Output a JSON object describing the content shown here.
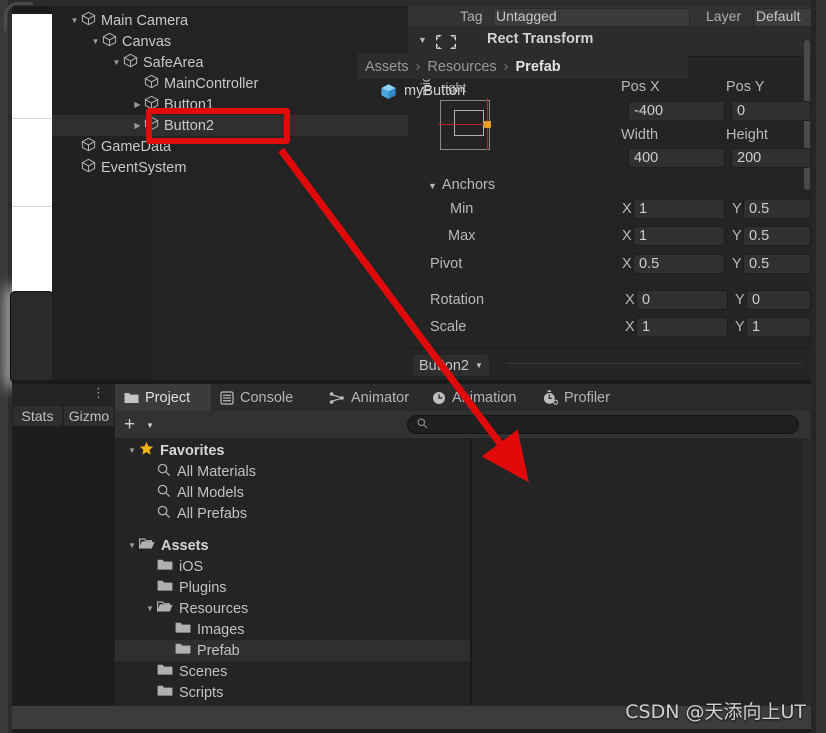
{
  "app": "Unity Editor",
  "hierarchy": {
    "items": [
      {
        "label": "Main Camera",
        "indent": 0,
        "expander": "down",
        "icon": "gameobject-cube-icon",
        "selected": false
      },
      {
        "label": "Canvas",
        "indent": 1,
        "expander": "down",
        "icon": "gameobject-cube-icon",
        "selected": false
      },
      {
        "label": "SafeArea",
        "indent": 2,
        "expander": "down",
        "icon": "gameobject-cube-icon",
        "selected": false
      },
      {
        "label": "MainController",
        "indent": 3,
        "expander": "none",
        "icon": "gameobject-cube-icon",
        "selected": false
      },
      {
        "label": "Button1",
        "indent": 3,
        "expander": "right",
        "icon": "gameobject-cube-icon",
        "selected": false
      },
      {
        "label": "Button2",
        "indent": 3,
        "expander": "right",
        "icon": "gameobject-cube-icon",
        "selected": true
      },
      {
        "label": "GameData",
        "indent": 0,
        "expander": "none",
        "icon": "gameobject-cube-icon",
        "selected": false
      },
      {
        "label": "EventSystem",
        "indent": 0,
        "expander": "none",
        "icon": "gameobject-cube-icon",
        "selected": false
      }
    ]
  },
  "inspector": {
    "tag_label": "Tag",
    "tag_value": "Untagged",
    "layer_label": "Layer",
    "layer_value": "Default",
    "component": {
      "title": "Rect Transform",
      "icon": "rect-transform-icon",
      "anchor_preset": {
        "horizontal": "right",
        "vertical": "middle"
      },
      "fields": {
        "pos_x_label": "Pos X",
        "pos_x_value": "-400",
        "pos_y_label": "Pos Y",
        "pos_y_value": "0",
        "width_label": "Width",
        "width_value": "400",
        "height_label": "Height",
        "height_value": "200",
        "anchors_label": "Anchors",
        "min_label": "Min",
        "min_x": "1",
        "min_y": "0.5",
        "max_label": "Max",
        "max_x": "1",
        "max_y": "0.5",
        "pivot_label": "Pivot",
        "pivot_x": "0.5",
        "pivot_y": "0.5",
        "rotation_label": "Rotation",
        "rotation_x": "0",
        "rotation_y": "0",
        "scale_label": "Scale",
        "scale_x": "1",
        "scale_y": "1",
        "axis_x": "X",
        "axis_y": "Y"
      }
    },
    "footer_dropdown": "Button2"
  },
  "scene_toolbar": {
    "stats_label": "Stats",
    "gizmos_label": "Gizmo"
  },
  "project": {
    "tabs": [
      {
        "label": "Project",
        "icon": "folder-icon",
        "active": true
      },
      {
        "label": "Console",
        "icon": "console-icon",
        "active": false
      },
      {
        "label": "Animator",
        "icon": "animator-icon",
        "active": false
      },
      {
        "label": "Animation",
        "icon": "animation-clock-icon",
        "active": false
      },
      {
        "label": "Profiler",
        "icon": "profiler-stopwatch-icon",
        "active": false
      }
    ],
    "toolbar": {
      "create_label": "+",
      "search_placeholder": ""
    },
    "tree": [
      {
        "label": "Favorites",
        "indent": 0,
        "expander": "down",
        "icon": "star-icon",
        "bold": true,
        "selected": false
      },
      {
        "label": "All Materials",
        "indent": 1,
        "expander": "none",
        "icon": "search-icon",
        "bold": false,
        "selected": false
      },
      {
        "label": "All Models",
        "indent": 1,
        "expander": "none",
        "icon": "search-icon",
        "bold": false,
        "selected": false
      },
      {
        "label": "All Prefabs",
        "indent": 1,
        "expander": "none",
        "icon": "search-icon",
        "bold": false,
        "selected": false
      },
      {
        "label": "Assets",
        "indent": 0,
        "expander": "down",
        "icon": "folder-open-icon",
        "bold": true,
        "selected": false
      },
      {
        "label": "iOS",
        "indent": 1,
        "expander": "none",
        "icon": "folder-icon",
        "bold": false,
        "selected": false
      },
      {
        "label": "Plugins",
        "indent": 1,
        "expander": "none",
        "icon": "folder-icon",
        "bold": false,
        "selected": false
      },
      {
        "label": "Resources",
        "indent": 1,
        "expander": "down",
        "icon": "folder-open-icon",
        "bold": false,
        "selected": false
      },
      {
        "label": "Images",
        "indent": 2,
        "expander": "none",
        "icon": "folder-icon",
        "bold": false,
        "selected": false
      },
      {
        "label": "Prefab",
        "indent": 2,
        "expander": "none",
        "icon": "folder-icon",
        "bold": false,
        "selected": true
      },
      {
        "label": "Scenes",
        "indent": 1,
        "expander": "none",
        "icon": "folder-icon",
        "bold": false,
        "selected": false
      },
      {
        "label": "Scripts",
        "indent": 1,
        "expander": "none",
        "icon": "folder-icon",
        "bold": false,
        "selected": false
      }
    ],
    "breadcrumb": [
      "Assets",
      "Resources",
      "Prefab"
    ],
    "assets": [
      {
        "label": "myButton",
        "icon": "prefab-cube-icon"
      }
    ]
  },
  "annotations": {
    "highlight_target": "Button2",
    "arrow_from": "Button2",
    "arrow_to": "myButton",
    "color": "#e10a0a"
  },
  "watermark": "CSDN @天添向上UT"
}
